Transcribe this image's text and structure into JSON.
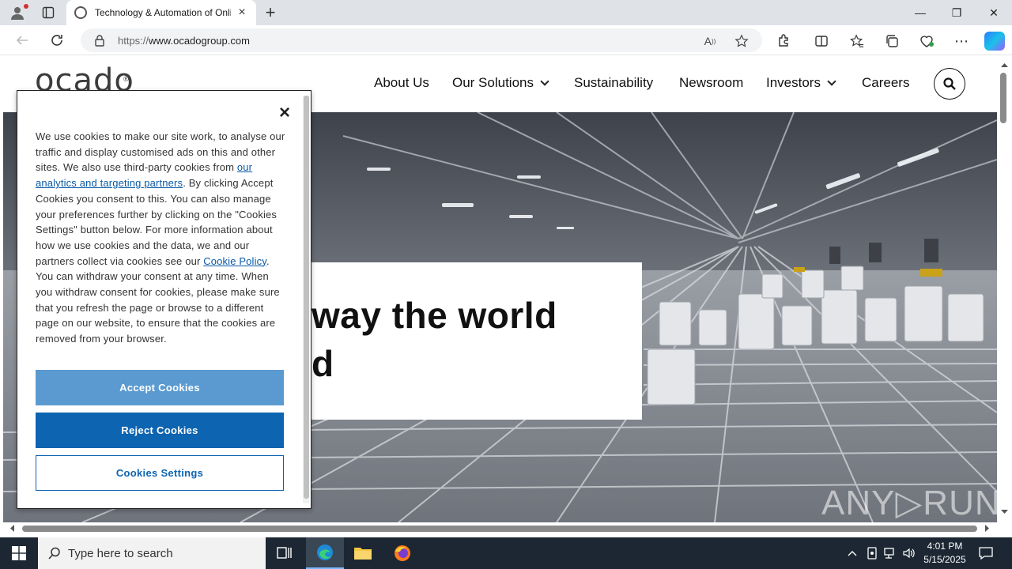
{
  "browser": {
    "tab_title": "Technology & Automation of Online Grocery Retail",
    "url_prefix": "https://",
    "url_host": "www.ocadogroup.com",
    "new_tab_glyph": "+",
    "tab_close_glyph": "×",
    "minimize_glyph": "—",
    "restore_glyph": "❐",
    "close_glyph": "✕"
  },
  "site": {
    "logo": "ocado",
    "logo_mark": "®",
    "nav": [
      {
        "label": "About Us",
        "has_dropdown": false
      },
      {
        "label": "Our Solutions",
        "has_dropdown": true
      },
      {
        "label": "Sustainability",
        "has_dropdown": false
      },
      {
        "label": "Newsroom",
        "has_dropdown": false
      },
      {
        "label": "Investors",
        "has_dropdown": true
      },
      {
        "label": "Careers",
        "has_dropdown": false
      }
    ],
    "hero": {
      "heading_line1": "way the world",
      "heading_line2": "d"
    },
    "watermark": "ANY▷RUN"
  },
  "cookie_banner": {
    "close_glyph": "×",
    "text_1": "We use cookies to make our site work, to analyse our traffic and display customised ads on this and other sites. We also use third-party cookies from ",
    "link_partners": "our analytics and targeting partners",
    "text_2": ". By clicking Accept Cookies you consent to this. You can also manage your preferences further by clicking on the \"Cookies Settings\" button below. For more information about how we use cookies and the data, we and our partners collect via cookies see our ",
    "link_policy": "Cookie Policy",
    "text_3": ". You can withdraw your consent at any time. When you withdraw consent for cookies, please make sure that you refresh the page or browse to a different page on our website, to ensure that the cookies are removed from your browser.",
    "accept_label": "Accept Cookies",
    "reject_label": "Reject Cookies",
    "settings_label": "Cookies Settings"
  },
  "taskbar": {
    "search_placeholder": "Type here to search",
    "time": "4:01 PM",
    "date": "5/15/2025"
  },
  "colors": {
    "accept_button": "#5a9ad0",
    "reject_button": "#0d64b0",
    "link": "#0a5aa8",
    "taskbar": "#1c2733"
  }
}
